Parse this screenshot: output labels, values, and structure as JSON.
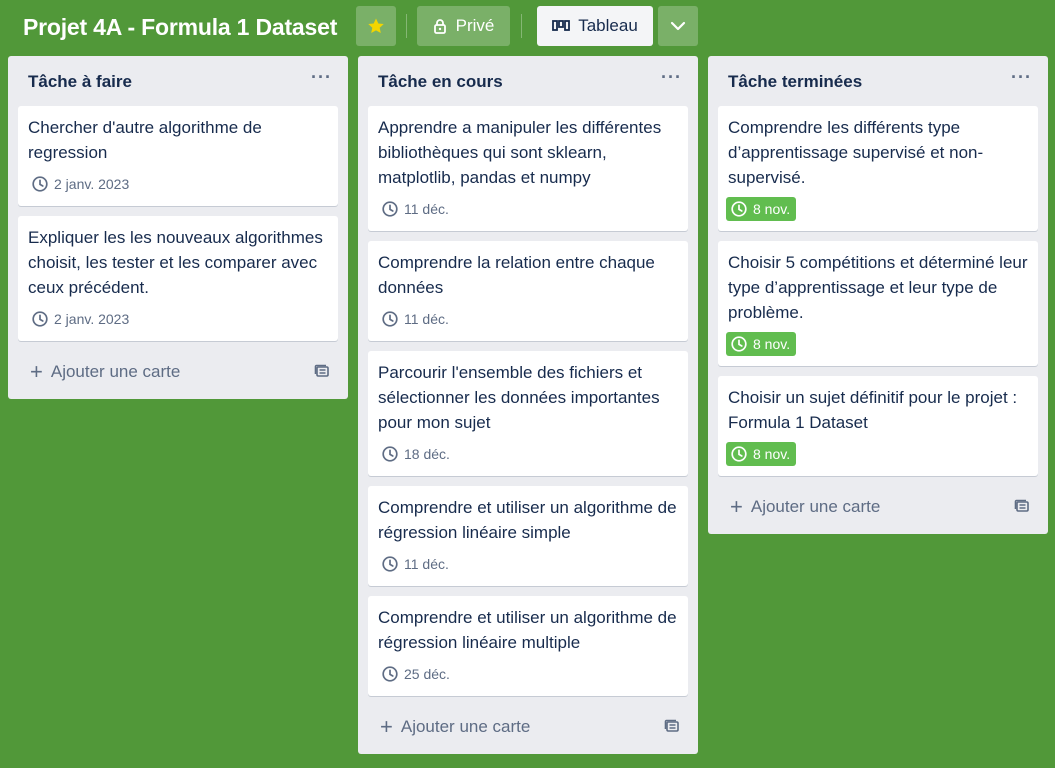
{
  "header": {
    "title": "Projet 4A - Formula 1 Dataset",
    "private_label": "Privé",
    "view_label": "Tableau",
    "star_color": "#f2d600"
  },
  "lists": [
    {
      "title": "Tâche à faire",
      "menu": "···",
      "cards": [
        {
          "text": "Chercher d'autre algorithme de regression",
          "date": "2 janv. 2023",
          "done": false
        },
        {
          "text": "Expliquer les les nouveaux algorithmes choisit, les tester et les comparer avec ceux précédent.",
          "date": "2 janv. 2023",
          "done": false
        }
      ],
      "add_label": "Ajouter une carte"
    },
    {
      "title": "Tâche en cours",
      "menu": "···",
      "cards": [
        {
          "text": "Apprendre a manipuler les différentes bibliothèques qui sont sklearn, matplotlib, pandas et numpy",
          "date": "11 déc.",
          "done": false
        },
        {
          "text": "Comprendre la relation entre chaque données",
          "date": "11 déc.",
          "done": false
        },
        {
          "text": "Parcourir l'ensemble des fichiers et sélectionner les données importantes pour mon sujet",
          "date": "18 déc.",
          "done": false
        },
        {
          "text": "Comprendre et utiliser un algorithme de régression linéaire simple",
          "date": "11 déc.",
          "done": false
        },
        {
          "text": "Comprendre et utiliser un algorithme de régression linéaire multiple",
          "date": "25 déc.",
          "done": false
        }
      ],
      "add_label": "Ajouter une carte"
    },
    {
      "title": "Tâche terminées",
      "menu": "···",
      "cards": [
        {
          "text": "Comprendre les différents type d’apprentissage supervisé et non-supervisé.",
          "date": "8 nov.",
          "done": true
        },
        {
          "text": "Choisir 5 compétitions et déterminé leur type d’apprentissage et leur type de problème.",
          "date": "8 nov.",
          "done": true
        },
        {
          "text": "Choisir un sujet définitif pour le projet : Formula 1 Dataset",
          "date": "8 nov.",
          "done": true
        }
      ],
      "add_label": "Ajouter une carte"
    }
  ],
  "colors": {
    "board_bg": "#519839",
    "list_bg": "#ebecf0",
    "done_badge": "#61bd4f"
  }
}
